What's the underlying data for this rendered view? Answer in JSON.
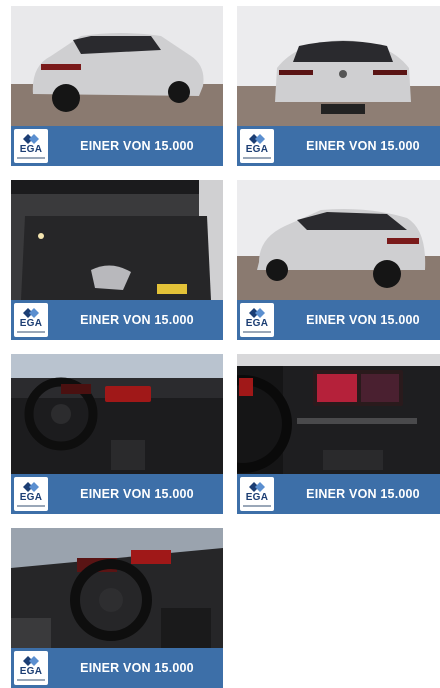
{
  "gallery": {
    "tiles": [
      {
        "view": "car-rear-left-exterior",
        "logo": "EGA",
        "banner": "EINER VON 15.000"
      },
      {
        "view": "car-rear-exterior",
        "logo": "EGA",
        "banner": "EINER VON 15.000"
      },
      {
        "view": "car-trunk-interior",
        "logo": "EGA",
        "banner": "EINER VON 15.000"
      },
      {
        "view": "car-rear-right-exterior",
        "logo": "EGA",
        "banner": "EINER VON 15.000"
      },
      {
        "view": "car-dashboard-interior",
        "logo": "EGA",
        "banner": "EINER VON 15.000"
      },
      {
        "view": "car-infotainment-display",
        "logo": "EGA",
        "banner": "EINER VON 15.000"
      },
      {
        "view": "car-steering-wheel-interior",
        "logo": "EGA",
        "banner": "EINER VON 15.000"
      }
    ]
  },
  "colors": {
    "banner": "#3d6fa8",
    "logo_text": "#1c3e74",
    "car_body": "#c9c9cb"
  }
}
